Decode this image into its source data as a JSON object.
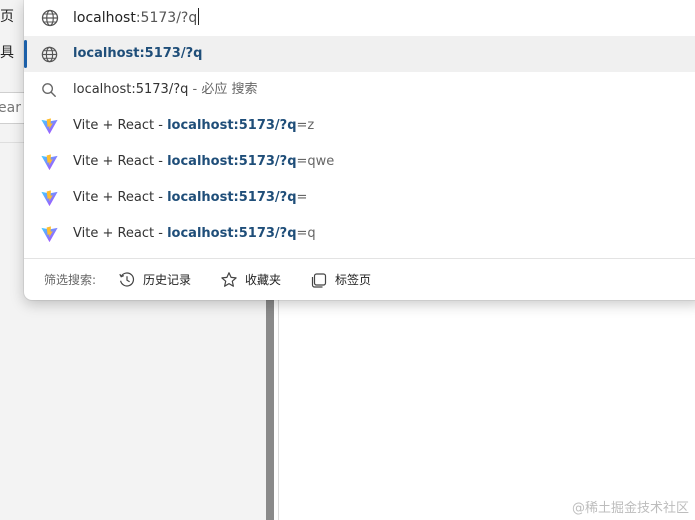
{
  "background": {
    "left_char_top": "页",
    "left_char_second": "具",
    "search_fragment": "ear"
  },
  "address_bar": {
    "typed_host": "localhost",
    "typed_rest": ":5173/?q",
    "icon": "globe-icon"
  },
  "suggestions": [
    {
      "icon": "globe-icon",
      "selected": true,
      "prefix": "",
      "bold": "localhost:5173/?q",
      "suffix": ""
    },
    {
      "icon": "search-icon",
      "selected": false,
      "prefix": "localhost:5173/?q",
      "bold": "",
      "suffix": " - 必应 搜索"
    },
    {
      "icon": "vite-logo-icon",
      "selected": false,
      "prefix": "Vite + React - ",
      "bold": "localhost:5173/?q",
      "suffix": "=z"
    },
    {
      "icon": "vite-logo-icon",
      "selected": false,
      "prefix": "Vite + React - ",
      "bold": "localhost:5173/?q",
      "suffix": "=qwe"
    },
    {
      "icon": "vite-logo-icon",
      "selected": false,
      "prefix": "Vite + React - ",
      "bold": "localhost:5173/?q",
      "suffix": "="
    },
    {
      "icon": "vite-logo-icon",
      "selected": false,
      "prefix": "Vite + React - ",
      "bold": "localhost:5173/?q",
      "suffix": "=q"
    }
  ],
  "filter": {
    "label": "筛选搜索:",
    "history": "历史记录",
    "favorites": "收藏夹",
    "tabs": "标签页"
  },
  "watermark": "@稀土掘金技术社区",
  "colors": {
    "accent_bar": "#1b5fa8",
    "bold_text": "#1f4e79",
    "selected_bg": "#f0f0f0"
  }
}
